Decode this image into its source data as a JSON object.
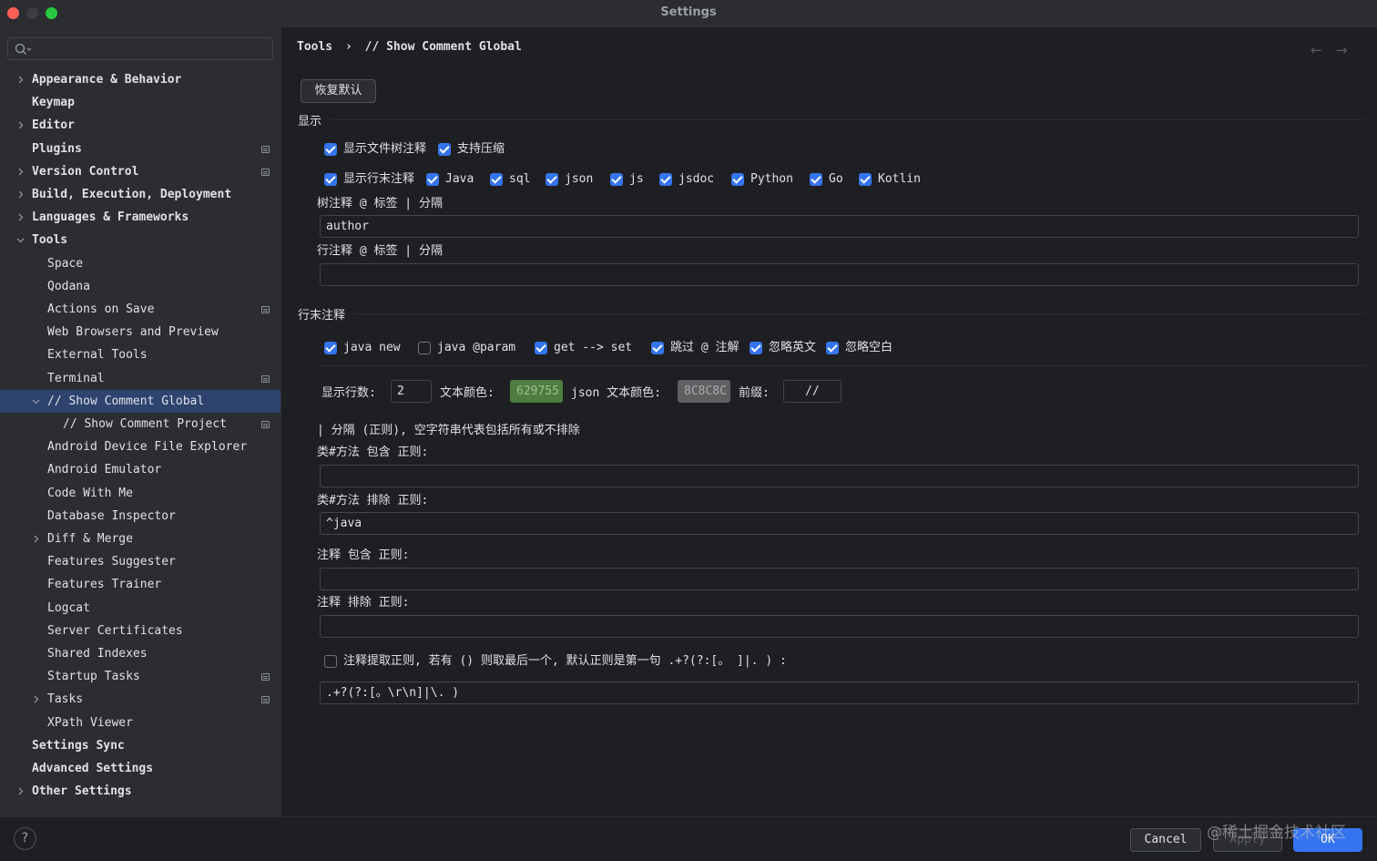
{
  "window": {
    "title": "Settings"
  },
  "search": {
    "placeholder": ""
  },
  "sidebar": {
    "items": [
      {
        "label": "Appearance & Behavior"
      },
      {
        "label": "Keymap"
      },
      {
        "label": "Editor"
      },
      {
        "label": "Plugins"
      },
      {
        "label": "Version Control"
      },
      {
        "label": "Build, Execution, Deployment"
      },
      {
        "label": "Languages & Frameworks"
      },
      {
        "label": "Tools"
      },
      {
        "label": "Space"
      },
      {
        "label": "Qodana"
      },
      {
        "label": "Actions on Save"
      },
      {
        "label": "Web Browsers and Preview"
      },
      {
        "label": "External Tools"
      },
      {
        "label": "Terminal"
      },
      {
        "label": "// Show Comment Global"
      },
      {
        "label": "// Show Comment Project"
      },
      {
        "label": "Android Device File Explorer"
      },
      {
        "label": "Android Emulator"
      },
      {
        "label": "Code With Me"
      },
      {
        "label": "Database Inspector"
      },
      {
        "label": "Diff & Merge"
      },
      {
        "label": "Features Suggester"
      },
      {
        "label": "Features Trainer"
      },
      {
        "label": "Logcat"
      },
      {
        "label": "Server Certificates"
      },
      {
        "label": "Shared Indexes"
      },
      {
        "label": "Startup Tasks"
      },
      {
        "label": "Tasks"
      },
      {
        "label": "XPath Viewer"
      },
      {
        "label": "Settings Sync"
      },
      {
        "label": "Advanced Settings"
      },
      {
        "label": "Other Settings"
      }
    ]
  },
  "breadcrumb": {
    "parent": "Tools",
    "separator": "›",
    "current": "// Show Comment Global"
  },
  "nav": {
    "back": "←",
    "forward": "→"
  },
  "main": {
    "restore_button": "恢复默认",
    "display_section": "显示",
    "display_options": [
      {
        "label": "显示文件树注释",
        "checked": true
      },
      {
        "label": "支持压缩",
        "checked": true
      }
    ],
    "line_options": [
      {
        "label": "显示行末注释",
        "checked": true
      },
      {
        "label": "Java",
        "checked": true
      },
      {
        "label": "sql",
        "checked": true
      },
      {
        "label": "json",
        "checked": true
      },
      {
        "label": "js",
        "checked": true
      },
      {
        "label": "jsdoc",
        "checked": true
      },
      {
        "label": "Python",
        "checked": true
      },
      {
        "label": "Go",
        "checked": true
      },
      {
        "label": "Kotlin",
        "checked": true
      }
    ],
    "tree_tag_label": "树注释 @ 标签 | 分隔",
    "tree_tag_value": "author",
    "line_tag_label": "行注释 @ 标签 | 分隔",
    "line_tag_value": "",
    "line_end_section": "行末注释",
    "line_end_options": [
      {
        "label": "java new",
        "checked": true
      },
      {
        "label": "java @param",
        "checked": false
      },
      {
        "label": "get --> set",
        "checked": true
      },
      {
        "label": "跳过 @ 注解",
        "checked": true
      },
      {
        "label": "忽略英文",
        "checked": true
      },
      {
        "label": "忽略空白",
        "checked": true
      }
    ],
    "lines_label": "显示行数:",
    "lines_value": "2",
    "text_color_label": "文本颜色:",
    "text_color_value": "629755",
    "json_color_label": "json 文本颜色:",
    "json_color_value": "8C8C8C",
    "prefix_label": "前缀:",
    "prefix_value": "//",
    "regex_hint": "| 分隔 (正则), 空字符串代表包括所有或不排除",
    "class_include_label": "类#方法 包含 正则:",
    "class_include_value": "",
    "class_exclude_label": "类#方法 排除 正则:",
    "class_exclude_value": "^java",
    "comment_include_label": "注释 包含 正则:",
    "comment_include_value": "",
    "comment_exclude_label": "注释 排除 正则:",
    "comment_exclude_value": "",
    "extract_label": "注释提取正则, 若有 () 则取最后一个, 默认正则是第一句 .+?(?:[。  ]|. ) :",
    "extract_checked": false,
    "extract_value": ".+?(?:[。\\r\\n]|\\. )"
  },
  "footer": {
    "help": "?",
    "cancel": "Cancel",
    "apply": "Apply",
    "ok": "OK",
    "watermark": "@稀土掘金技术社区"
  },
  "colors": {
    "accent": "#3574f0",
    "selection": "#2e436e",
    "text_color_swatch": "#4f7c40",
    "json_color_swatch": "#5e5f61"
  }
}
